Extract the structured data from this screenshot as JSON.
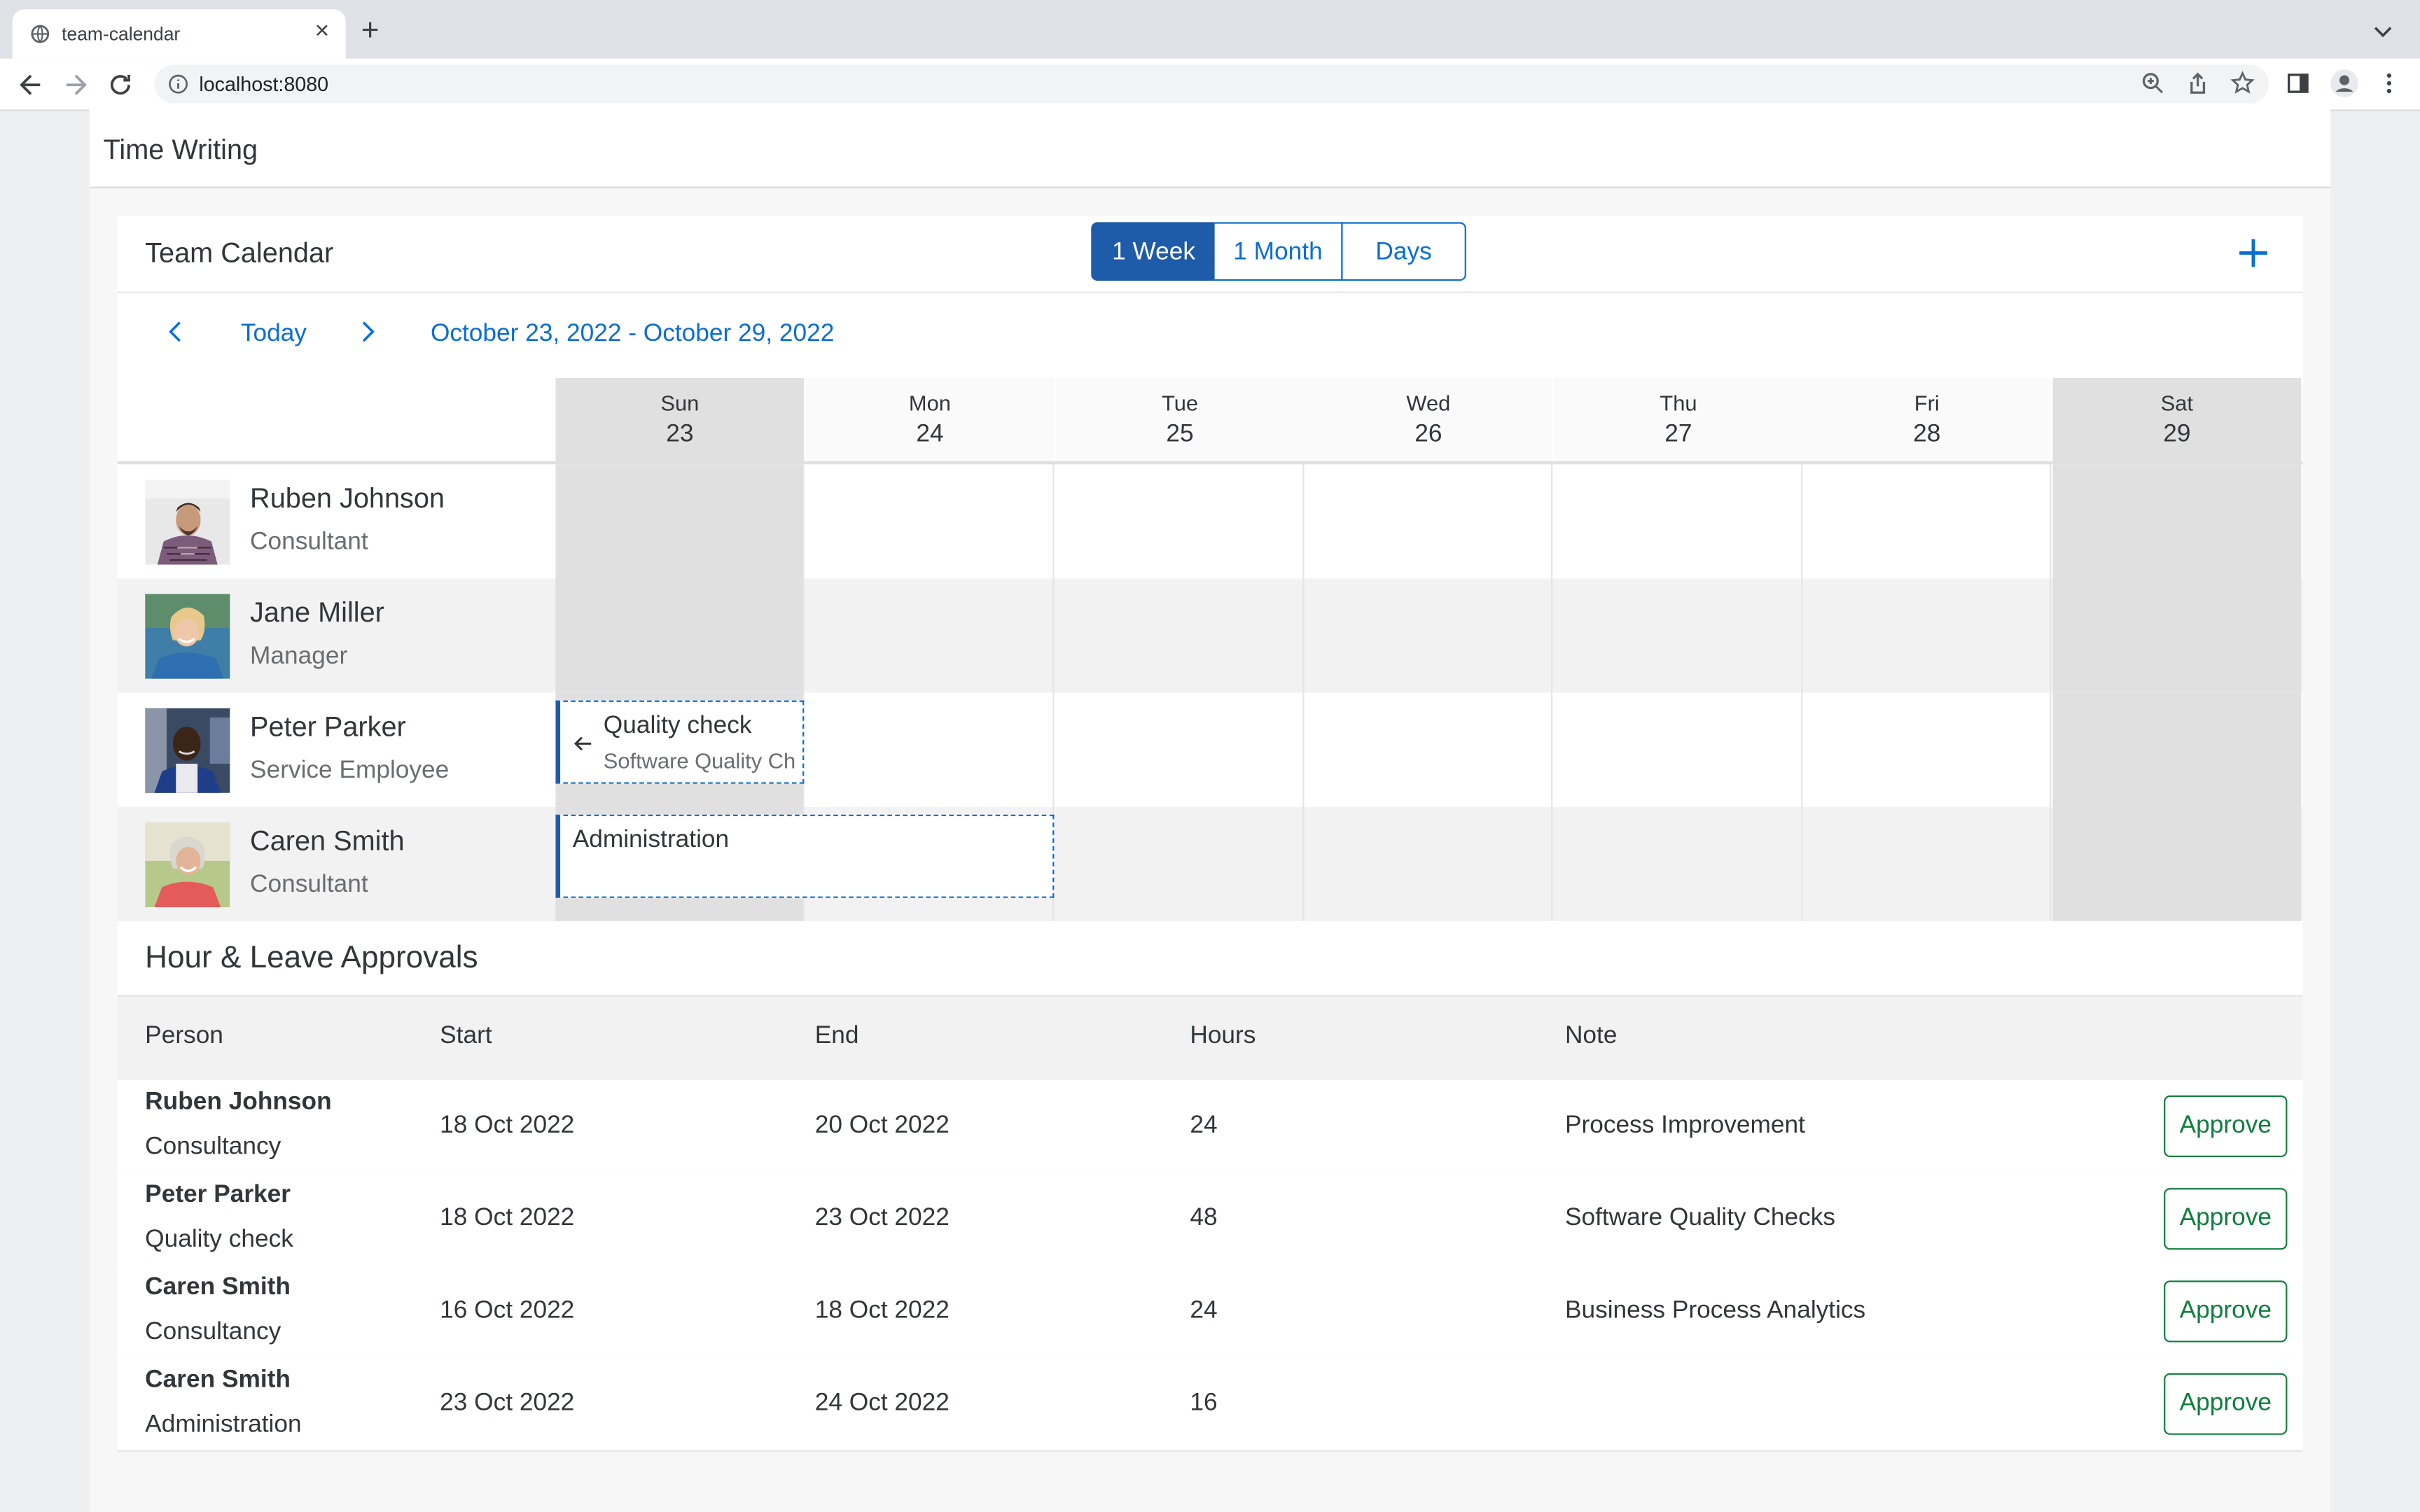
{
  "browser": {
    "tab_title": "team-calendar",
    "url": "localhost:8080"
  },
  "app": {
    "title": "Time Writing"
  },
  "calendar": {
    "title": "Team Calendar",
    "views": [
      "1 Week",
      "1 Month",
      "Days"
    ],
    "active_view": "1 Week",
    "today_label": "Today",
    "date_range": "October 23, 2022 - October 29, 2022",
    "days": [
      {
        "name": "Sun",
        "date": "23",
        "weekend": true
      },
      {
        "name": "Mon",
        "date": "24",
        "weekend": false
      },
      {
        "name": "Tue",
        "date": "25",
        "weekend": false
      },
      {
        "name": "Wed",
        "date": "26",
        "weekend": false
      },
      {
        "name": "Thu",
        "date": "27",
        "weekend": false
      },
      {
        "name": "Fri",
        "date": "28",
        "weekend": false
      },
      {
        "name": "Sat",
        "date": "29",
        "weekend": true
      }
    ],
    "people": [
      {
        "name": "Ruben Johnson",
        "role": "Consultant"
      },
      {
        "name": "Jane Miller",
        "role": "Manager"
      },
      {
        "name": "Peter Parker",
        "role": "Service Employee"
      },
      {
        "name": "Caren Smith",
        "role": "Consultant"
      }
    ],
    "appointments": [
      {
        "person": "Peter Parker",
        "title": "Quality check",
        "subtitle": "Software Quality Ch"
      },
      {
        "person": "Caren Smith",
        "title": "Administration"
      }
    ]
  },
  "approvals": {
    "title": "Hour & Leave Approvals",
    "columns": [
      "Person",
      "Start",
      "End",
      "Hours",
      "Note"
    ],
    "approve_label": "Approve",
    "rows": [
      {
        "person": "Ruben Johnson",
        "type": "Consultancy",
        "start": "18 Oct 2022",
        "end": "20 Oct 2022",
        "hours": "24",
        "note": "Process Improvement"
      },
      {
        "person": "Peter Parker",
        "type": "Quality check",
        "start": "18 Oct 2022",
        "end": "23 Oct 2022",
        "hours": "48",
        "note": "Software Quality Checks"
      },
      {
        "person": "Caren Smith",
        "type": "Consultancy",
        "start": "16 Oct 2022",
        "end": "18 Oct 2022",
        "hours": "24",
        "note": "Business Process Analytics"
      },
      {
        "person": "Caren Smith",
        "type": "Administration",
        "start": "23 Oct 2022",
        "end": "24 Oct 2022",
        "hours": "16",
        "note": ""
      }
    ]
  },
  "colors": {
    "accent": "#0a6ed1",
    "active_segment": "#1e5ba8",
    "approve": "#107e3e",
    "weekend": "#e0e0e0"
  }
}
